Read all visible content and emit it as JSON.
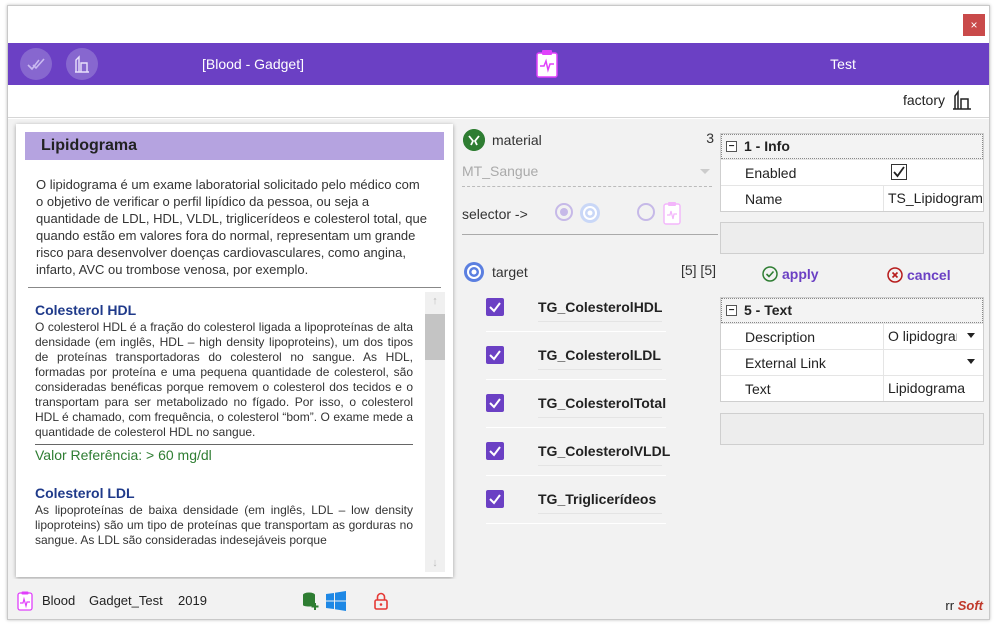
{
  "window": {
    "close_label": "×"
  },
  "header": {
    "app_title": "[Blood - Gadget]",
    "test_label": "Test"
  },
  "factory_bar": {
    "label": "factory"
  },
  "doc": {
    "title": "Lipidograma",
    "intro": "O lipidograma é um exame laboratorial solicitado pelo médico com o objetivo de verificar o perfil lipídico da pessoa, ou seja a quantidade de LDL, HDL, VLDL, triglicerídeos e colesterol total, que quando estão em valores fora do normal, representam um grande risco para desenvolver doenças cardiovasculares, como angina, infarto, AVC ou trombose venosa, por exemplo.",
    "sections": [
      {
        "title": "Colesterol HDL",
        "text": "O colesterol HDL é a fração do colesterol ligada a lipoproteínas de alta densidade (em inglês, HDL – high density lipoproteins), um dos tipos de proteínas transportadoras do colesterol no sangue. As HDL, formadas por proteína e uma pequena quantidade de colesterol, são consideradas benéficas porque removem o colesterol dos tecidos e o transportam para ser metabolizado no fígado. Por isso, o colesterol HDL é chamado, com frequência, o colesterol “bom”. O exame mede a quantidade de colesterol HDL no sangue.",
        "reference": "Valor Referência: > 60 mg/dl"
      },
      {
        "title": "Colesterol LDL",
        "text": "As lipoproteínas de baixa densidade (em inglês, LDL – low density lipoproteins) são um tipo de proteínas que transportam as gorduras no sangue. As LDL são consideradas indesejáveis porque"
      }
    ]
  },
  "material": {
    "label": "material",
    "count": "3",
    "selected": "MT_Sangue"
  },
  "selector": {
    "label": "selector ->"
  },
  "target": {
    "label": "target",
    "count": "[5] [5]",
    "items": [
      "TG_ColesterolHDL",
      "TG_ColesterolLDL",
      "TG_ColesterolTotal",
      "TG_ColesterolVLDL",
      "TG_Triglicerídeos"
    ]
  },
  "info_grid": {
    "header": "1 - Info",
    "enabled_label": "Enabled",
    "enabled": true,
    "name_label": "Name",
    "name_value": "TS_Lipidograma"
  },
  "actions": {
    "apply": "apply",
    "cancel": "cancel"
  },
  "text_grid": {
    "header": "5 - Text",
    "description_label": "Description",
    "description_value": "O lipidograma é um exame",
    "external_link_label": "External Link",
    "external_link_value": "",
    "text_label": "Text",
    "text_value": "Lipidograma"
  },
  "status": {
    "item1": "Blood",
    "item2": "Gadget_Test",
    "item3": "2019",
    "brand_prefix": "rr",
    "brand_name": "Soft"
  },
  "colors": {
    "accent": "#6b40c4",
    "title_band": "#b5a3e0",
    "link_blue": "#1f3a8a",
    "ref_green": "#2e7d32",
    "lock_red": "#e53935"
  }
}
